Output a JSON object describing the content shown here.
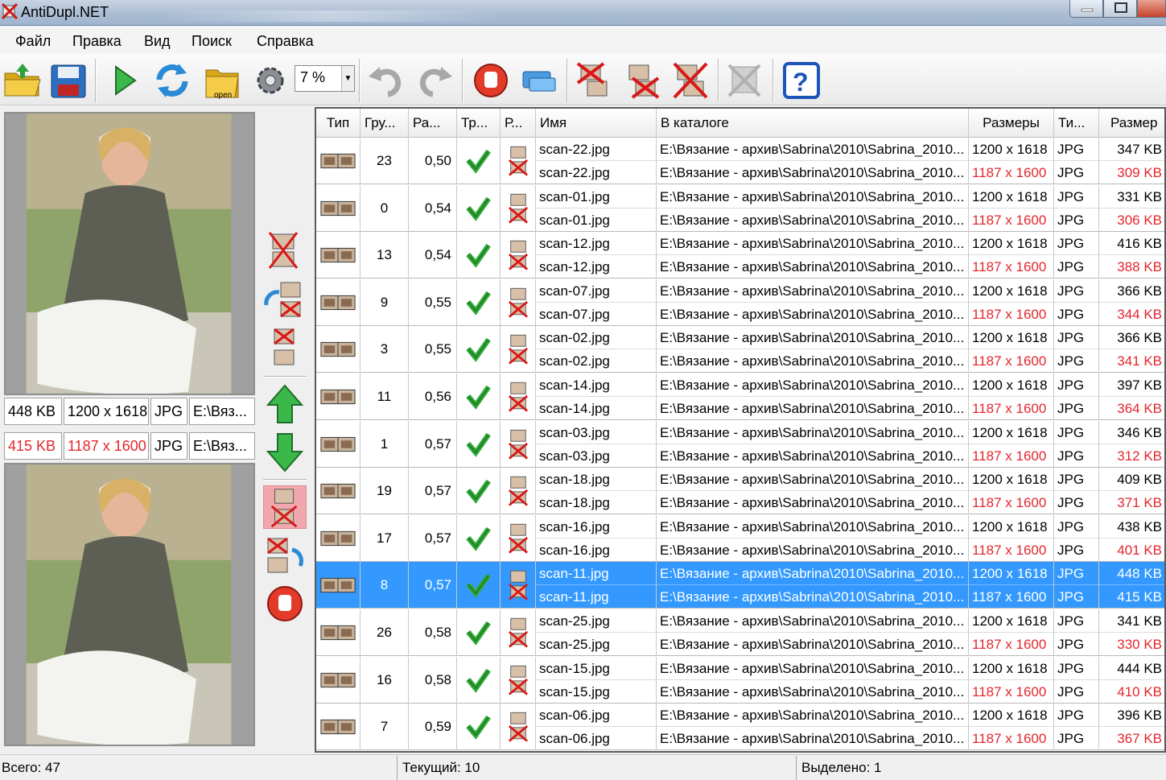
{
  "window": {
    "title": "AntiDupl.NET"
  },
  "menu": [
    "Файл",
    "Правка",
    "Вид",
    "Поиск",
    "Справка"
  ],
  "toolbar": {
    "zoom_value": "7 %",
    "open_label": "open",
    "buttons": [
      "open-folder",
      "save",
      "start-search",
      "refresh",
      "open-profile",
      "options",
      "zoom",
      "undo",
      "redo",
      "stop",
      "check-update",
      "delete-first",
      "delete-second",
      "delete-both",
      "mistake",
      "help"
    ]
  },
  "preview": {
    "first": {
      "size": "448 KB",
      "resolution": "1200 x 1618",
      "type": "JPG",
      "path": "E:\\Вяз..."
    },
    "second": {
      "size": "415 KB",
      "resolution": "1187 x 1600",
      "type": "JPG",
      "path": "E:\\Вяз..."
    }
  },
  "colors": {
    "selection": "#3399ff",
    "worse_value": "#e3262c",
    "header_bg": "#ececec"
  },
  "columns": [
    "Тип",
    "Гру...",
    "Ра...",
    "Тр...",
    "Р...",
    "Имя",
    "В каталоге",
    "Размеры",
    "Ти...",
    "Размер"
  ],
  "rows": [
    {
      "group": "23",
      "diff": "0,50",
      "name1": "scan-22.jpg",
      "name2": "scan-22.jpg",
      "dir1": "E:\\Вязание - архив\\Sabrina\\2010\\Sabrina_2010...",
      "dir2": "E:\\Вязание - архив\\Sabrina\\2010\\Sabrina_2010...",
      "res1": "1200 x 1618",
      "res2": "1187 x 1600",
      "type1": "JPG",
      "type2": "JPG",
      "size1": "347 KB",
      "size2": "309 KB"
    },
    {
      "group": "0",
      "diff": "0,54",
      "name1": "scan-01.jpg",
      "name2": "scan-01.jpg",
      "dir1": "E:\\Вязание - архив\\Sabrina\\2010\\Sabrina_2010...",
      "dir2": "E:\\Вязание - архив\\Sabrina\\2010\\Sabrina_2010...",
      "res1": "1200 x 1618",
      "res2": "1187 x 1600",
      "type1": "JPG",
      "type2": "JPG",
      "size1": "331 KB",
      "size2": "306 KB"
    },
    {
      "group": "13",
      "diff": "0,54",
      "name1": "scan-12.jpg",
      "name2": "scan-12.jpg",
      "dir1": "E:\\Вязание - архив\\Sabrina\\2010\\Sabrina_2010...",
      "dir2": "E:\\Вязание - архив\\Sabrina\\2010\\Sabrina_2010...",
      "res1": "1200 x 1618",
      "res2": "1187 x 1600",
      "type1": "JPG",
      "type2": "JPG",
      "size1": "416 KB",
      "size2": "388 KB"
    },
    {
      "group": "9",
      "diff": "0,55",
      "name1": "scan-07.jpg",
      "name2": "scan-07.jpg",
      "dir1": "E:\\Вязание - архив\\Sabrina\\2010\\Sabrina_2010...",
      "dir2": "E:\\Вязание - архив\\Sabrina\\2010\\Sabrina_2010...",
      "res1": "1200 x 1618",
      "res2": "1187 x 1600",
      "type1": "JPG",
      "type2": "JPG",
      "size1": "366 KB",
      "size2": "344 KB"
    },
    {
      "group": "3",
      "diff": "0,55",
      "name1": "scan-02.jpg",
      "name2": "scan-02.jpg",
      "dir1": "E:\\Вязание - архив\\Sabrina\\2010\\Sabrina_2010...",
      "dir2": "E:\\Вязание - архив\\Sabrina\\2010\\Sabrina_2010...",
      "res1": "1200 x 1618",
      "res2": "1187 x 1600",
      "type1": "JPG",
      "type2": "JPG",
      "size1": "366 KB",
      "size2": "341 KB"
    },
    {
      "group": "11",
      "diff": "0,56",
      "name1": "scan-14.jpg",
      "name2": "scan-14.jpg",
      "dir1": "E:\\Вязание - архив\\Sabrina\\2010\\Sabrina_2010...",
      "dir2": "E:\\Вязание - архив\\Sabrina\\2010\\Sabrina_2010...",
      "res1": "1200 x 1618",
      "res2": "1187 x 1600",
      "type1": "JPG",
      "type2": "JPG",
      "size1": "397 KB",
      "size2": "364 KB"
    },
    {
      "group": "1",
      "diff": "0,57",
      "name1": "scan-03.jpg",
      "name2": "scan-03.jpg",
      "dir1": "E:\\Вязание - архив\\Sabrina\\2010\\Sabrina_2010...",
      "dir2": "E:\\Вязание - архив\\Sabrina\\2010\\Sabrina_2010...",
      "res1": "1200 x 1618",
      "res2": "1187 x 1600",
      "type1": "JPG",
      "type2": "JPG",
      "size1": "346 KB",
      "size2": "312 KB"
    },
    {
      "group": "19",
      "diff": "0,57",
      "name1": "scan-18.jpg",
      "name2": "scan-18.jpg",
      "dir1": "E:\\Вязание - архив\\Sabrina\\2010\\Sabrina_2010...",
      "dir2": "E:\\Вязание - архив\\Sabrina\\2010\\Sabrina_2010...",
      "res1": "1200 x 1618",
      "res2": "1187 x 1600",
      "type1": "JPG",
      "type2": "JPG",
      "size1": "409 KB",
      "size2": "371 KB"
    },
    {
      "group": "17",
      "diff": "0,57",
      "name1": "scan-16.jpg",
      "name2": "scan-16.jpg",
      "dir1": "E:\\Вязание - архив\\Sabrina\\2010\\Sabrina_2010...",
      "dir2": "E:\\Вязание - архив\\Sabrina\\2010\\Sabrina_2010...",
      "res1": "1200 x 1618",
      "res2": "1187 x 1600",
      "type1": "JPG",
      "type2": "JPG",
      "size1": "438 KB",
      "size2": "401 KB"
    },
    {
      "group": "8",
      "diff": "0,57",
      "name1": "scan-11.jpg",
      "name2": "scan-11.jpg",
      "dir1": "E:\\Вязание - архив\\Sabrina\\2010\\Sabrina_2010...",
      "dir2": "E:\\Вязание - архив\\Sabrina\\2010\\Sabrina_2010...",
      "res1": "1200 x 1618",
      "res2": "1187 x 1600",
      "type1": "JPG",
      "type2": "JPG",
      "size1": "448 KB",
      "size2": "415 KB",
      "selected": true
    },
    {
      "group": "26",
      "diff": "0,58",
      "name1": "scan-25.jpg",
      "name2": "scan-25.jpg",
      "dir1": "E:\\Вязание - архив\\Sabrina\\2010\\Sabrina_2010...",
      "dir2": "E:\\Вязание - архив\\Sabrina\\2010\\Sabrina_2010...",
      "res1": "1200 x 1618",
      "res2": "1187 x 1600",
      "type1": "JPG",
      "type2": "JPG",
      "size1": "341 KB",
      "size2": "330 KB"
    },
    {
      "group": "16",
      "diff": "0,58",
      "name1": "scan-15.jpg",
      "name2": "scan-15.jpg",
      "dir1": "E:\\Вязание - архив\\Sabrina\\2010\\Sabrina_2010...",
      "dir2": "E:\\Вязание - архив\\Sabrina\\2010\\Sabrina_2010...",
      "res1": "1200 x 1618",
      "res2": "1187 x 1600",
      "type1": "JPG",
      "type2": "JPG",
      "size1": "444 KB",
      "size2": "410 KB"
    },
    {
      "group": "7",
      "diff": "0,59",
      "name1": "scan-06.jpg",
      "name2": "scan-06.jpg",
      "dir1": "E:\\Вязание - архив\\Sabrina\\2010\\Sabrina_2010...",
      "dir2": "E:\\Вязание - архив\\Sabrina\\2010\\Sabrina_2010...",
      "res1": "1200 x 1618",
      "res2": "1187 x 1600",
      "type1": "JPG",
      "type2": "JPG",
      "size1": "396 KB",
      "size2": "367 KB"
    }
  ],
  "status": {
    "total": "Всего: 47",
    "current": "Текущий: 10",
    "selected": "Выделено: 1"
  }
}
